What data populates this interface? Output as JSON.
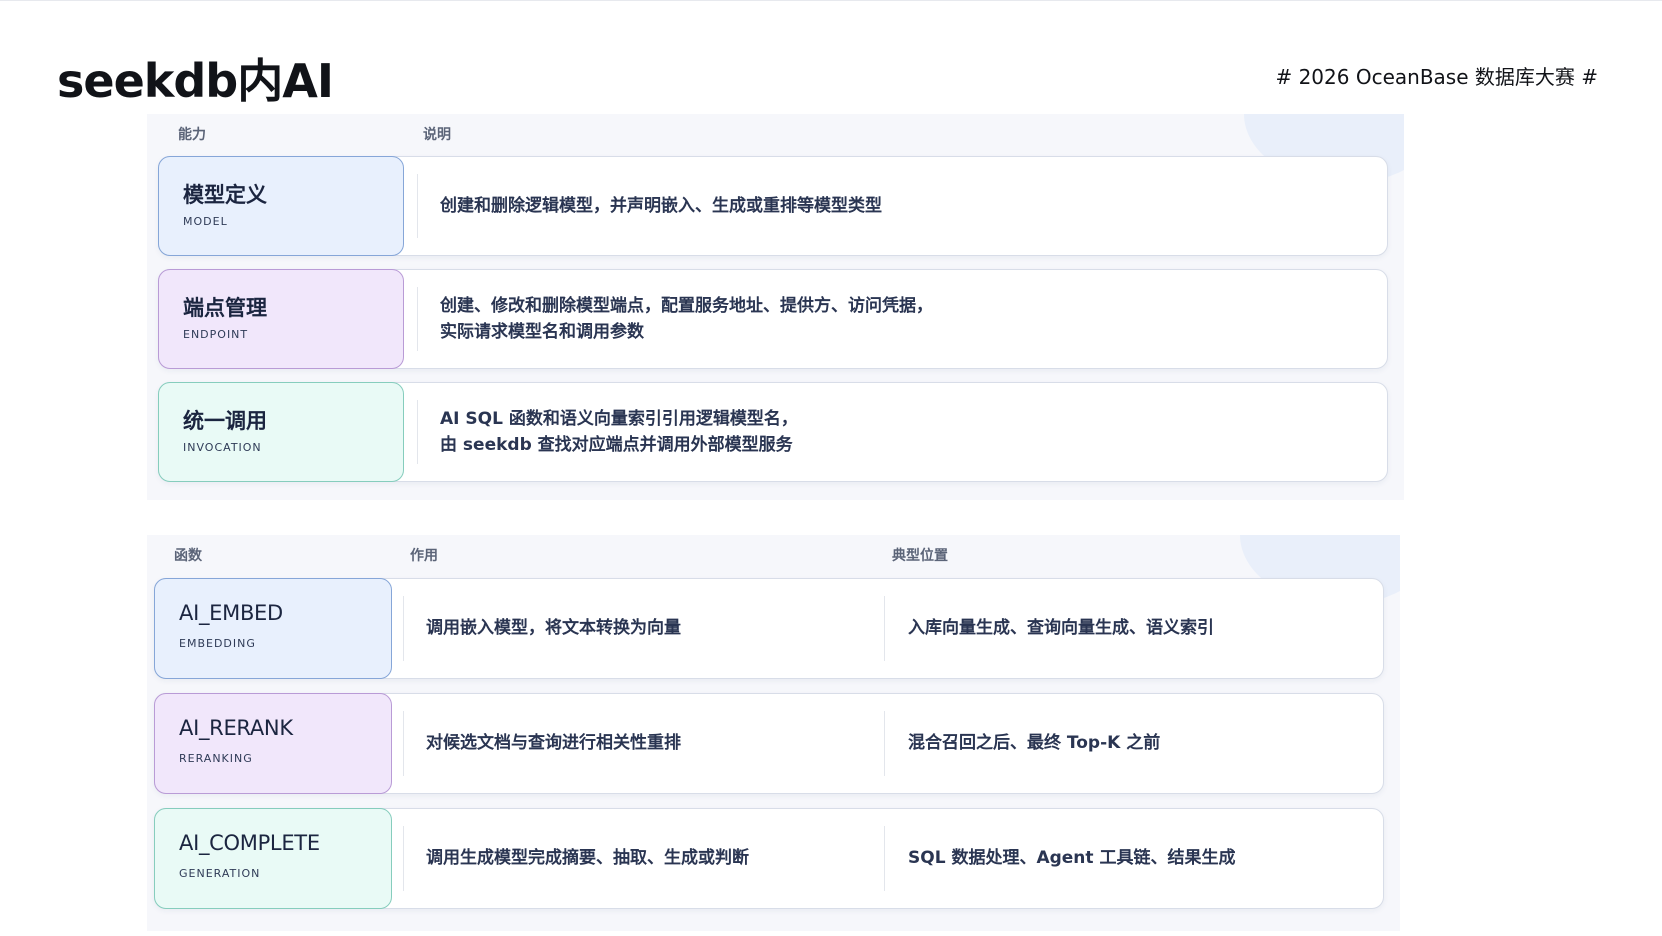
{
  "page": {
    "title": "seekdb内AI",
    "event_tag": "# 2026 OceanBase 数据库大赛 #"
  },
  "capabilities": {
    "headers": {
      "capability": "能力",
      "description": "说明"
    },
    "rows": [
      {
        "name": "模型定义",
        "code": "MODEL",
        "color": "#e8f0fd",
        "desc_line1": "创建和删除逻辑模型，并声明嵌入、生成或重排等模型类型",
        "desc_line2": ""
      },
      {
        "name": "端点管理",
        "code": "ENDPOINT",
        "color": "#f1e7fb",
        "desc_line1": "创建、修改和删除模型端点，配置服务地址、提供方、访问凭据，",
        "desc_line2": "实际请求模型名和调用参数"
      },
      {
        "name": "统一调用",
        "code": "INVOCATION",
        "color": "#e9faf6",
        "desc_line1": "AI SQL 函数和语义向量索引引用逻辑模型名，",
        "desc_line2": "由 seekdb 查找对应端点并调用外部模型服务"
      }
    ]
  },
  "functions": {
    "headers": {
      "function": "函数",
      "purpose": "作用",
      "typical_position": "典型位置"
    },
    "rows": [
      {
        "name": "AI_EMBED",
        "code": "EMBEDDING",
        "color": "#e8f0fd",
        "purpose": "调用嵌入模型，将文本转换为向量",
        "position": "入库向量生成、查询向量生成、语义索引"
      },
      {
        "name": "AI_RERANK",
        "code": "RERANKING",
        "color": "#f1e7fb",
        "purpose": "对候选文档与查询进行相关性重排",
        "position": "混合召回之后、最终 Top-K 之前"
      },
      {
        "name": "AI_COMPLETE",
        "code": "GENERATION",
        "color": "#e9faf6",
        "purpose": "调用生成模型完成摘要、抽取、生成或判断",
        "position": "SQL 数据处理、Agent 工具链、结果生成"
      }
    ]
  }
}
